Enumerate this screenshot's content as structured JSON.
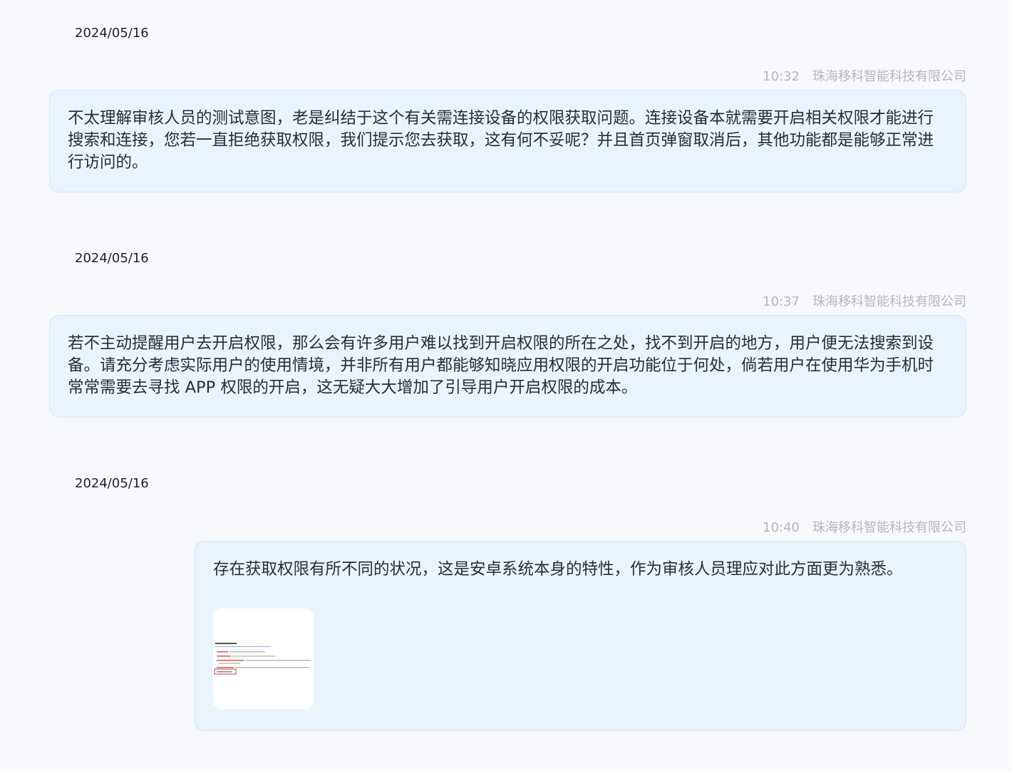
{
  "messages": [
    {
      "date": "2024/05/16",
      "time": "10:32",
      "sender": "珠海移科智能科技有限公司",
      "text": "不太理解审核人员的测试意图，老是纠结于这个有关需连接设备的权限获取问题。连接设备本就需要开启相关权限才能进行搜索和连接，您若一直拒绝获取权限，我们提示您去获取，这有何不妥呢？并且首页弹窗取消后，其他功能都是能够正常进行访问的。"
    },
    {
      "date": "2024/05/16",
      "time": "10:37",
      "sender": "珠海移科智能科技有限公司",
      "text": "若不主动提醒用户去开启权限，那么会有许多用户难以找到开启权限的所在之处，找不到开启的地方，用户便无法搜索到设备。请充分考虑实际用户的使用情境，并非所有用户都能够知晓应用权限的开启功能位于何处，倘若用户在使用华为手机时常常需要去寻找 APP 权限的开启，这无疑大大增加了引导用户开启权限的成本。"
    },
    {
      "date": "2024/05/16",
      "time": "10:40",
      "sender": "珠海移科智能科技有限公司",
      "text": "存在获取权限有所不同的状况，这是安卓系统本身的特性，作为审核人员理应对此方面更为熟悉。",
      "attachment": "image-thumbnail"
    }
  ]
}
